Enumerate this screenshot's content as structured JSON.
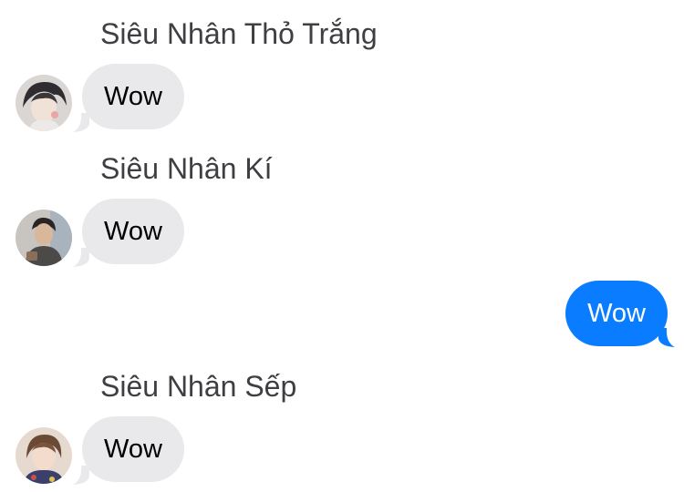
{
  "colors": {
    "incoming_bubble": "#e9e9eb",
    "outgoing_bubble": "#0a7cff",
    "incoming_text": "#000000",
    "outgoing_text": "#ffffff",
    "sender_name": "#3f3f43"
  },
  "messages": [
    {
      "direction": "incoming",
      "sender": "Siêu Nhân Thỏ Trắng",
      "text": "Wow",
      "avatar": "user-photo-avatar"
    },
    {
      "direction": "incoming",
      "sender": "Siêu Nhân Kí",
      "text": "Wow",
      "avatar": "user-photo-avatar"
    },
    {
      "direction": "outgoing",
      "text": "Wow"
    },
    {
      "direction": "incoming",
      "sender": "Siêu Nhân Sếp",
      "text": "Wow",
      "avatar": "user-photo-avatar"
    }
  ]
}
